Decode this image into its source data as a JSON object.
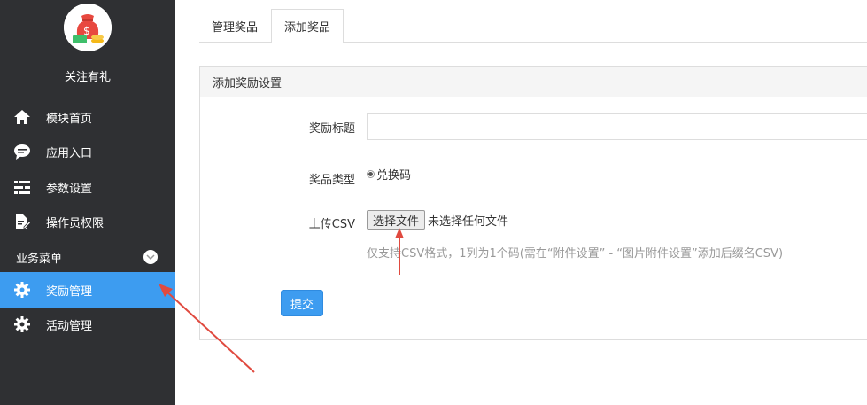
{
  "sidebar": {
    "app_name": "关注有礼",
    "nav_items": [
      {
        "label": "模块首页",
        "icon": "home-icon"
      },
      {
        "label": "应用入口",
        "icon": "chat-bubble-icon"
      },
      {
        "label": "参数设置",
        "icon": "list-settings-icon"
      },
      {
        "label": "操作员权限",
        "icon": "edit-document-icon"
      }
    ],
    "section_title": "业务菜单",
    "business_items": [
      {
        "label": "奖励管理",
        "icon": "gear-icon",
        "active": true
      },
      {
        "label": "活动管理",
        "icon": "gear-icon",
        "active": false
      }
    ]
  },
  "tabs": [
    {
      "label": "管理奖品",
      "active": false
    },
    {
      "label": "添加奖品",
      "active": true
    }
  ],
  "panel": {
    "title": "添加奖励设置",
    "fields": {
      "title_label": "奖励标题",
      "title_value": "",
      "type_label": "奖品类型",
      "type_option": "兑换码",
      "upload_label": "上传CSV",
      "file_button": "选择文件",
      "file_status": "未选择任何文件",
      "hint": "仅支持CSV格式，1列为1个码(需在“附件设置” - “图片附件设置”添加后缀名CSV)"
    },
    "submit": "提交"
  },
  "colors": {
    "sidebar_bg": "#2f3033",
    "accent": "#3d9cf0",
    "annotation_arrow": "#e04a3f"
  }
}
